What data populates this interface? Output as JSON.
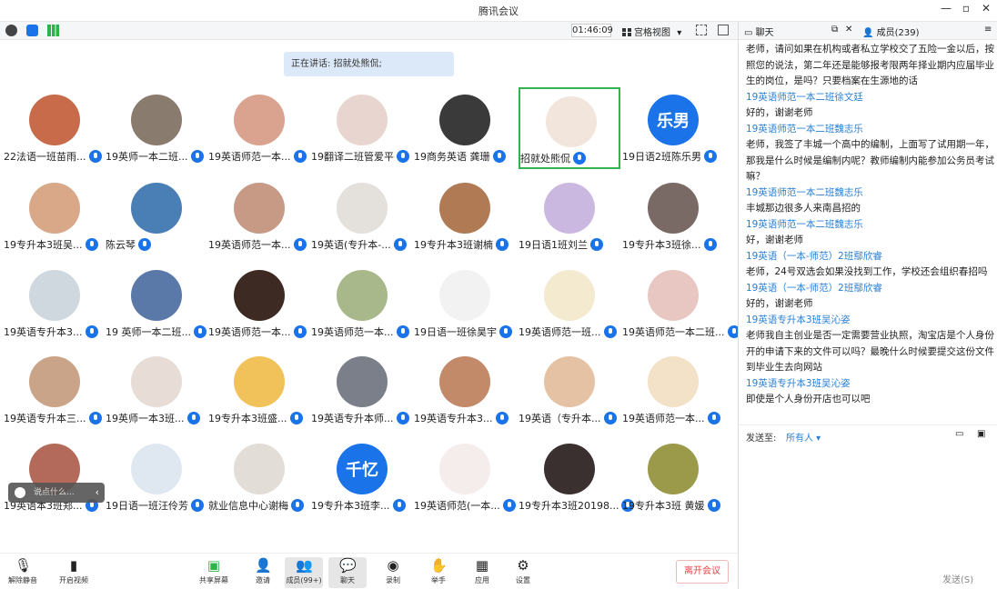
{
  "app": {
    "title": "腾讯会议"
  },
  "window_controls": [
    "—",
    "▫",
    "✕"
  ],
  "toolbar": {
    "timer": "01:46:09",
    "view_label": "宫格视图",
    "view_caret": "▾"
  },
  "speaking_banner": "正在讲话: 招就处熊侃;",
  "participants": [
    {
      "name": "22法语一班苗雨...",
      "color": "#c76b4a"
    },
    {
      "name": "19英师一本二班...",
      "color": "#8a7b6f"
    },
    {
      "name": "19英语师范一本...",
      "color": "#d9a38f"
    },
    {
      "name": "19翻译二班管爱平",
      "color": "#e8d5d0"
    },
    {
      "name": "19商务英语 龚珊",
      "color": "#3a3a3a"
    },
    {
      "name": "招就处熊侃",
      "color": "#f2e6dc",
      "active": true
    },
    {
      "name": "19日语2班陈乐男",
      "color": "#1a73e8",
      "text": "乐男"
    },
    {
      "name": "19专升本3班吴...",
      "color": "#d8a888"
    },
    {
      "name": "陈云琴",
      "color": "#4a7fb5"
    },
    {
      "name": "19英语师范一本...",
      "color": "#c79a86"
    },
    {
      "name": "19英语(专升本-...",
      "color": "#e4e0dc"
    },
    {
      "name": "19专升本3班谢楠",
      "color": "#b07a55"
    },
    {
      "name": "19日语1班刘兰",
      "color": "#cbb8e0"
    },
    {
      "name": "19专升本3班徐...",
      "color": "#7a6a66"
    },
    {
      "name": "19英语专升本3...",
      "color": "#cfd8df"
    },
    {
      "name": "19 英师一本二班...",
      "color": "#5a78a8"
    },
    {
      "name": "19英语师范一本...",
      "color": "#3d2a22"
    },
    {
      "name": "19英语师范一本...",
      "color": "#a8b88a"
    },
    {
      "name": "19日语一班徐昊宇",
      "color": "#f2f2f2"
    },
    {
      "name": "19英语师范一班...",
      "color": "#f3ead0"
    },
    {
      "name": "19英语师范一本二班...",
      "color": "#e8c7c2"
    },
    {
      "name": "19英语专升本三...",
      "color": "#c9a488"
    },
    {
      "name": "19英师一本3班...",
      "color": "#e8dcd6"
    },
    {
      "name": "19专升本3班盛...",
      "color": "#f2c25a"
    },
    {
      "name": "19英语专升本师...",
      "color": "#7a7f8a"
    },
    {
      "name": "19英语专升本3...",
      "color": "#c38a6a"
    },
    {
      "name": "19英语（专升本...",
      "color": "#e6c2a4"
    },
    {
      "name": "19英语师范一本...",
      "color": "#f3e2c8"
    },
    {
      "name": "19英语本3班郑...",
      "color": "#b36a5a"
    },
    {
      "name": "19日语一班汪伶芳",
      "color": "#dfe8f0"
    },
    {
      "name": "就业信息中心谢梅",
      "color": "#e2ddd6"
    },
    {
      "name": "19专升本3班李...",
      "color": "#1a73e8",
      "text": "千忆"
    },
    {
      "name": "19英语师范(一本...",
      "color": "#f5ecec"
    },
    {
      "name": "19专升本3班20198...",
      "color": "#3a3030"
    },
    {
      "name": "19专升本3班 黄媛",
      "color": "#9a9a4a"
    }
  ],
  "quick_chat": {
    "placeholder": "说点什么...",
    "collapse": "‹"
  },
  "bottom": {
    "unmute": "解除静音",
    "video": "开启视频",
    "share": "共享屏幕",
    "invite": "邀请",
    "members": "成员(99+)",
    "chat": "聊天",
    "record": "录制",
    "raise_hand": "举手",
    "apps": "应用",
    "settings": "设置",
    "leave": "离开会议"
  },
  "side": {
    "chat_tab": "聊天",
    "members_tab": "成员(239)",
    "messages": [
      {
        "who": "",
        "text": "老师，请问如果在机构或者私立学校交了五险一金以后，按照您的说法，第二年还是能够报考限两年择业期内应届毕业生的岗位，是吗？只要档案在生源地的话"
      },
      {
        "who": "19英语师范一本二班徐文廷",
        "text": "好的，谢谢老师"
      },
      {
        "who": "19英语师范一本二班魏志乐",
        "text": "老师，我签了丰城一个高中的编制，上面写了试用期一年，那我是什么时候是编制内呢？教师编制内能参加公务员考试嘛？"
      },
      {
        "who": "19英语师范一本二班魏志乐",
        "text": "丰城那边很多人来南昌招的"
      },
      {
        "who": "19英语师范一本二班魏志乐",
        "text": "好，谢谢老师"
      },
      {
        "who": "19英语（一本-师范）2班鄢欣睿",
        "text": "老师，24号双选会如果没找到工作，学校还会组织春招吗"
      },
      {
        "who": "19英语（一本-师范）2班鄢欣睿",
        "text": "好的，谢谢老师"
      },
      {
        "who": "19英语专升本3班吴沁姿",
        "text": "老师我自主创业是否一定需要营业执照，淘宝店是个人身份开的申请下来的文件可以吗？最晚什么时候要提交这份文件到毕业生去向网站"
      },
      {
        "who": "19英语专升本3班吴沁姿",
        "text": "即使是个人身份开店也可以吧"
      }
    ],
    "send_to_label": "发送至:",
    "send_to_value": "所有人 ▾",
    "send_button": "发送(S)"
  }
}
